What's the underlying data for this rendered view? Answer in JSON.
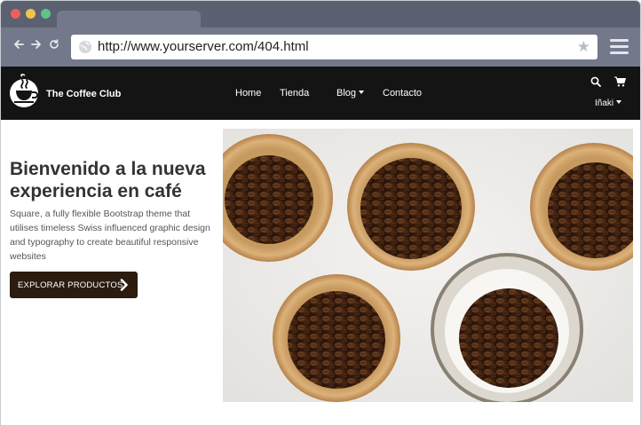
{
  "browser": {
    "url": "http://www.yourserver.com/404.html",
    "back_icon": "arrow-left-icon",
    "forward_icon": "arrow-right-icon",
    "reload_icon": "reload-icon",
    "bookmark_icon": "star-icon",
    "menu_icon": "hamburger-menu-icon"
  },
  "site": {
    "brand": "The Coffee Club",
    "nav": {
      "home": "Home",
      "shop": "Tienda",
      "blog": "Blog",
      "contact": "Contacto"
    },
    "user": "Iñaki"
  },
  "hero": {
    "title": "Bienvenido a la nueva experiencia en café",
    "description": "Square, a fully flexible Bootstrap theme that utilises timeless Swiss influenced graphic design and typography to create beautiful responsive websites",
    "cta_label": "EXPLORAR PRODUCTOS"
  },
  "colors": {
    "chrome_dark": "#5b6170",
    "chrome_light": "#73798a",
    "navbar": "#141414",
    "cta": "#2b1c0f"
  }
}
